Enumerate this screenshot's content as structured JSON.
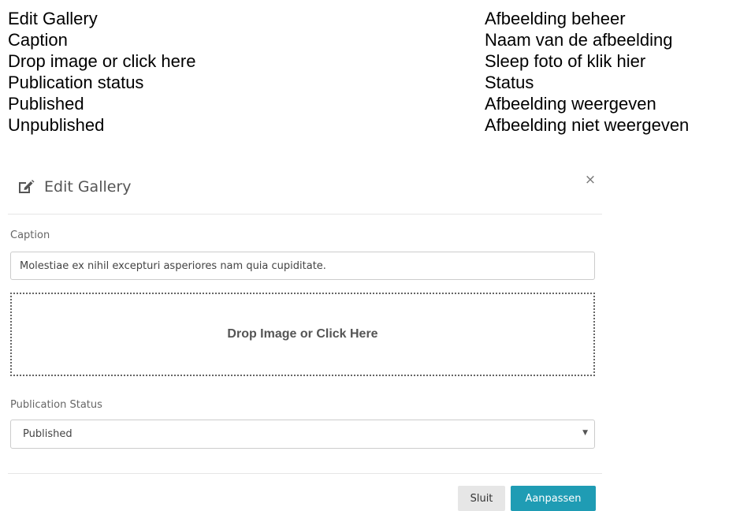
{
  "translations": [
    {
      "en": "Edit Gallery",
      "nl": "Afbeelding beheer"
    },
    {
      "en": "Caption",
      "nl": "Naam van de afbeelding"
    },
    {
      "en": "Drop image or click here",
      "nl": "Sleep foto of klik hier"
    },
    {
      "en": "Publication status",
      "nl": "Status"
    },
    {
      "en": "Published",
      "nl": "Afbeelding weergeven"
    },
    {
      "en": "Unpublished",
      "nl": "Afbeelding niet weergeven"
    }
  ],
  "modal": {
    "title": "Edit Gallery",
    "title_icon": "edit-icon",
    "close_symbol": "×",
    "caption_label": "Caption",
    "caption_value": "Molestiae ex nihil excepturi asperiores nam quia cupiditate.",
    "dropzone_text": "Drop Image or Click Here",
    "status_label": "Publication Status",
    "status_value": "Published",
    "select_arrow": "▼",
    "close_button": "Sluit",
    "save_button": "Aanpassen"
  },
  "colors": {
    "accent": "#1f9cb4",
    "secondary_button": "#e6e6e6"
  }
}
